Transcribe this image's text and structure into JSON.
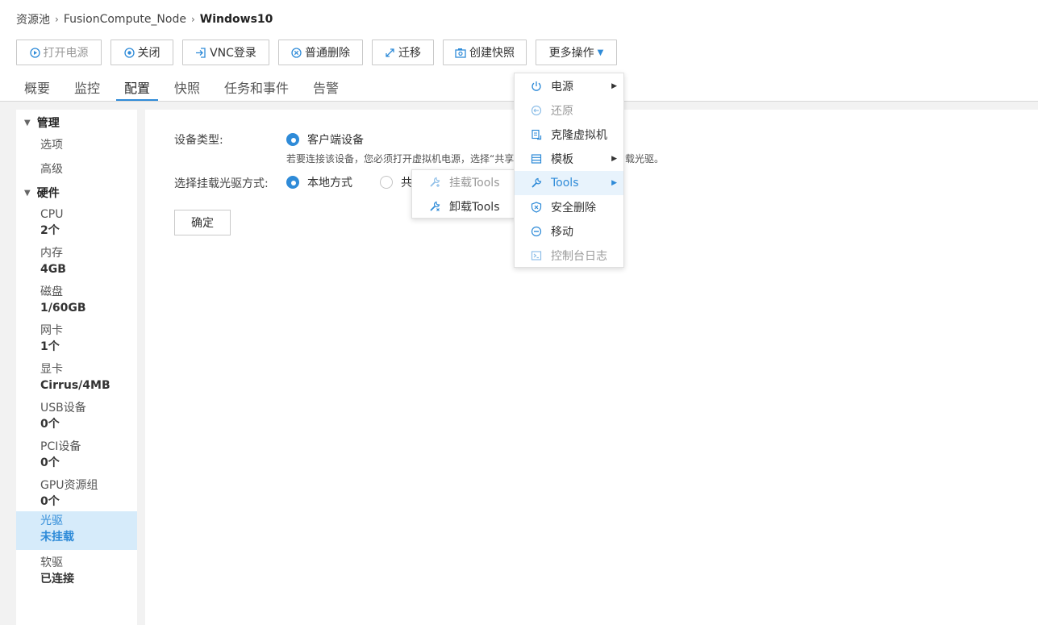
{
  "breadcrumb": {
    "items": [
      "资源池",
      "FusionCompute_Node"
    ],
    "current": "Windows10"
  },
  "toolbar": {
    "power_on": "打开电源",
    "shutdown": "关闭",
    "vnc_login": "VNC登录",
    "normal_delete": "普通删除",
    "migrate": "迁移",
    "create_snapshot": "创建快照",
    "more_actions": "更多操作"
  },
  "tabs": [
    "概要",
    "监控",
    "配置",
    "快照",
    "任务和事件",
    "告警"
  ],
  "active_tab": "配置",
  "sidebar": {
    "manage_group": "管理",
    "manage_items": [
      "选项",
      "高级"
    ],
    "hardware_group": "硬件",
    "hardware_items": [
      {
        "label": "CPU",
        "value": "2个"
      },
      {
        "label": "内存",
        "value": "4GB"
      },
      {
        "label": "磁盘",
        "value": "1/60GB"
      },
      {
        "label": "网卡",
        "value": "1个"
      },
      {
        "label": "显卡",
        "value": "Cirrus/4MB"
      },
      {
        "label": "USB设备",
        "value": "0个"
      },
      {
        "label": "PCI设备",
        "value": "0个"
      },
      {
        "label": "GPU资源组",
        "value": "0个"
      },
      {
        "label": "光驱",
        "value": "未挂载"
      },
      {
        "label": "软驱",
        "value": "已连接"
      }
    ]
  },
  "form": {
    "device_type_label": "设备类型:",
    "device_type_option": "客户端设备",
    "hint_left": "若要连接该设备，您必须打开虚拟机电源，选择“共享",
    "hint_right": "载光驱。",
    "mount_method_label": "选择挂载光驱方式:",
    "mount_local": "本地方式",
    "mount_shared": "共",
    "confirm": "确定"
  },
  "more_menu": {
    "items": [
      {
        "label": "电源",
        "icon": "power-icon",
        "submenu": true,
        "disabled": false
      },
      {
        "label": "还原",
        "icon": "restore-icon",
        "submenu": false,
        "disabled": true
      },
      {
        "label": "克隆虚拟机",
        "icon": "clone-icon",
        "submenu": false,
        "disabled": false
      },
      {
        "label": "模板",
        "icon": "template-icon",
        "submenu": true,
        "disabled": false
      },
      {
        "label": "Tools",
        "icon": "wrench-icon",
        "submenu": true,
        "disabled": false
      },
      {
        "label": "安全删除",
        "icon": "secure-delete-icon",
        "submenu": false,
        "disabled": false
      },
      {
        "label": "移动",
        "icon": "move-icon",
        "submenu": false,
        "disabled": false
      },
      {
        "label": "控制台日志",
        "icon": "console-log-icon",
        "submenu": false,
        "disabled": true
      }
    ]
  },
  "tools_menu": {
    "mount_tools": "挂载Tools",
    "unmount_tools": "卸载Tools"
  },
  "colors": {
    "accent": "#2f8bd8",
    "active_bg": "#d6ebfa",
    "page_bg": "#f2f2f2"
  }
}
